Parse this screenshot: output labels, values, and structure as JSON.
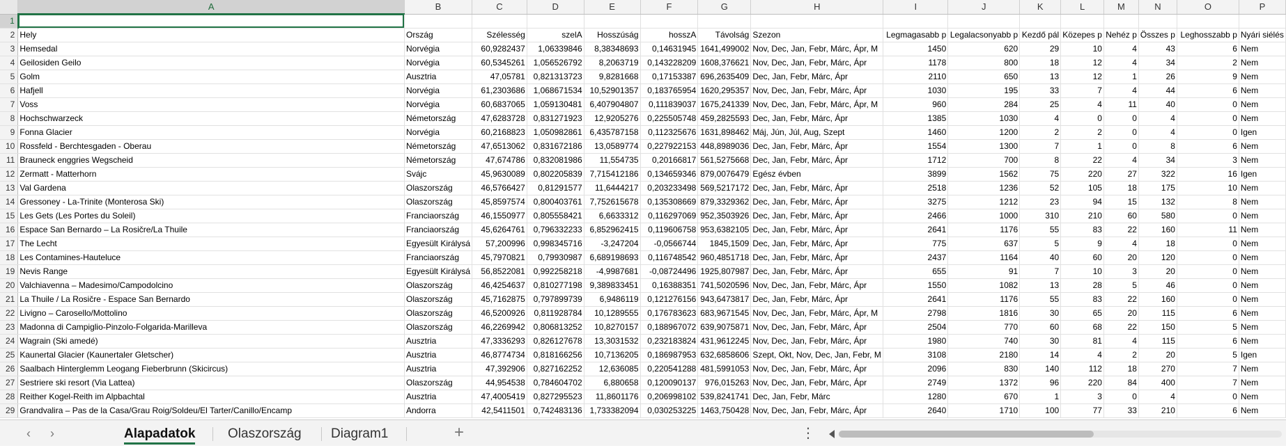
{
  "sheet": {
    "columns": [
      "A",
      "B",
      "C",
      "D",
      "E",
      "F",
      "G",
      "H",
      "I",
      "J",
      "K",
      "L",
      "M",
      "N",
      "O",
      "P"
    ],
    "row1": [
      "",
      "",
      "",
      "",
      "",
      "",
      "",
      "",
      "",
      "",
      "",
      "",
      "",
      "",
      "",
      ""
    ],
    "header_row": [
      "Hely",
      "Ország",
      "Szélesség",
      "szelA",
      "Hosszúság",
      "hosszA",
      "Távolság",
      "Szezon",
      "Legmagasabb p",
      "Legalacsonyabb p",
      "Kezdő pál",
      "Közepes p",
      "Nehéz p",
      "Összes p",
      "Leghosszabb p",
      "Nyári siélés"
    ],
    "rows": [
      [
        "Hemsedal",
        "Norvégia",
        "60,9282437",
        "1,06339846",
        "8,38348693",
        "0,14631945",
        "1641,499002",
        "Nov, Dec, Jan, Febr, Márc, Ápr, M",
        "1450",
        "620",
        "29",
        "10",
        "4",
        "43",
        "6",
        "Nem"
      ],
      [
        "Geilosiden Geilo",
        "Norvégia",
        "60,5345261",
        "1,056526792",
        "8,2063719",
        "0,143228209",
        "1608,376621",
        "Nov, Dec, Jan, Febr, Márc, Ápr",
        "1178",
        "800",
        "18",
        "12",
        "4",
        "34",
        "2",
        "Nem"
      ],
      [
        "Golm",
        "Ausztria",
        "47,05781",
        "0,821313723",
        "9,8281668",
        "0,17153387",
        "696,2635409",
        "Dec, Jan, Febr, Márc, Ápr",
        "2110",
        "650",
        "13",
        "12",
        "1",
        "26",
        "9",
        "Nem"
      ],
      [
        "Hafjell",
        "Norvégia",
        "61,2303686",
        "1,068671534",
        "10,52901357",
        "0,183765954",
        "1620,295357",
        "Nov, Dec, Jan, Febr, Márc, Ápr",
        "1030",
        "195",
        "33",
        "7",
        "4",
        "44",
        "6",
        "Nem"
      ],
      [
        "Voss",
        "Norvégia",
        "60,6837065",
        "1,059130481",
        "6,407904807",
        "0,111839037",
        "1675,241339",
        "Nov, Dec, Jan, Febr, Márc, Ápr, M",
        "960",
        "284",
        "25",
        "4",
        "11",
        "40",
        "0",
        "Nem"
      ],
      [
        "Hochschwarzeck",
        "Németország",
        "47,6283728",
        "0,831271923",
        "12,9205276",
        "0,225505748",
        "459,2825593",
        "Dec, Jan, Febr, Márc, Ápr",
        "1385",
        "1030",
        "4",
        "0",
        "0",
        "4",
        "0",
        "Nem"
      ],
      [
        "Fonna Glacier",
        "Norvégia",
        "60,2168823",
        "1,050982861",
        "6,435787158",
        "0,112325676",
        "1631,898462",
        "Máj, Jún, Júl, Aug, Szept",
        "1460",
        "1200",
        "2",
        "2",
        "0",
        "4",
        "0",
        "Igen"
      ],
      [
        "Rossfeld - Berchtesgaden - Oberau",
        "Németország",
        "47,6513062",
        "0,831672186",
        "13,0589774",
        "0,227922153",
        "448,8989036",
        "Dec, Jan, Febr, Márc, Ápr",
        "1554",
        "1300",
        "7",
        "1",
        "0",
        "8",
        "6",
        "Nem"
      ],
      [
        "Brauneck enggries Wegscheid",
        "Németország",
        "47,674786",
        "0,832081986",
        "11,554735",
        "0,20166817",
        "561,5275668",
        "Dec, Jan, Febr, Márc, Ápr",
        "1712",
        "700",
        "8",
        "22",
        "4",
        "34",
        "3",
        "Nem"
      ],
      [
        "Zermatt - Matterhorn",
        "Svájc",
        "45,9630089",
        "0,802205839",
        "7,715412186",
        "0,134659346",
        "879,0076479",
        "Egész évben",
        "3899",
        "1562",
        "75",
        "220",
        "27",
        "322",
        "16",
        "Igen"
      ],
      [
        "Val Gardena",
        "Olaszország",
        "46,5766427",
        "0,81291577",
        "11,6444217",
        "0,203233498",
        "569,5217172",
        "Dec, Jan, Febr, Márc, Ápr",
        "2518",
        "1236",
        "52",
        "105",
        "18",
        "175",
        "10",
        "Nem"
      ],
      [
        "Gressoney - La-Trinite (Monterosa Ski)",
        "Olaszország",
        "45,8597574",
        "0,800403761",
        "7,752615678",
        "0,135308669",
        "879,3329362",
        "Dec, Jan, Febr, Márc, Ápr",
        "3275",
        "1212",
        "23",
        "94",
        "15",
        "132",
        "8",
        "Nem"
      ],
      [
        "Les Gets (Les Portes du Soleil)",
        "Franciaország",
        "46,1550977",
        "0,805558421",
        "6,6633312",
        "0,116297069",
        "952,3503926",
        "Dec, Jan, Febr, Márc, Ápr",
        "2466",
        "1000",
        "310",
        "210",
        "60",
        "580",
        "0",
        "Nem"
      ],
      [
        "Espace San Bernardo – La Rosičre/La Thuile",
        "Franciaország",
        "45,6264761",
        "0,796332233",
        "6,852962415",
        "0,119606758",
        "953,6382105",
        "Dec, Jan, Febr, Márc, Ápr",
        "2641",
        "1176",
        "55",
        "83",
        "22",
        "160",
        "11",
        "Nem"
      ],
      [
        "The Lecht",
        "Egyesült Királysá",
        "57,200996",
        "0,998345716",
        "-3,247204",
        "-0,0566744",
        "1845,1509",
        "Dec, Jan, Febr, Márc, Ápr",
        "775",
        "637",
        "5",
        "9",
        "4",
        "18",
        "0",
        "Nem"
      ],
      [
        "Les Contamines-Hauteluce",
        "Franciaország",
        "45,7970821",
        "0,79930987",
        "6,689198693",
        "0,116748542",
        "960,4851718",
        "Dec, Jan, Febr, Márc, Ápr",
        "2437",
        "1164",
        "40",
        "60",
        "20",
        "120",
        "0",
        "Nem"
      ],
      [
        "Nevis Range",
        "Egyesült Királysá",
        "56,8522081",
        "0,992258218",
        "-4,9987681",
        "-0,08724496",
        "1925,807987",
        "Dec, Jan, Febr, Márc, Ápr",
        "655",
        "91",
        "7",
        "10",
        "3",
        "20",
        "0",
        "Nem"
      ],
      [
        "Valchiavenna – Madesimo/Campodolcino",
        "Olaszország",
        "46,4254637",
        "0,810277198",
        "9,389833451",
        "0,16388351",
        "741,5020596",
        "Nov, Dec, Jan, Febr, Márc, Ápr",
        "1550",
        "1082",
        "13",
        "28",
        "5",
        "46",
        "0",
        "Nem"
      ],
      [
        "La Thuile / La Rosičre - Espace San Bernardo",
        "Olaszország",
        "45,7162875",
        "0,797899739",
        "6,9486119",
        "0,121276156",
        "943,6473817",
        "Dec, Jan, Febr, Márc, Ápr",
        "2641",
        "1176",
        "55",
        "83",
        "22",
        "160",
        "0",
        "Nem"
      ],
      [
        "Livigno – Carosello/Mottolino",
        "Olaszország",
        "46,5200926",
        "0,811928784",
        "10,1289555",
        "0,176783623",
        "683,9671545",
        "Nov, Dec, Jan, Febr, Márc, Ápr, M",
        "2798",
        "1816",
        "30",
        "65",
        "20",
        "115",
        "6",
        "Nem"
      ],
      [
        "Madonna di Campiglio-Pinzolo-Folgarida-Marilleva",
        "Olaszország",
        "46,2269942",
        "0,806813252",
        "10,8270157",
        "0,188967072",
        "639,9075871",
        "Nov, Dec, Jan, Febr, Márc, Ápr",
        "2504",
        "770",
        "60",
        "68",
        "22",
        "150",
        "5",
        "Nem"
      ],
      [
        "Wagrain (Ski amedé)",
        "Ausztria",
        "47,3336293",
        "0,826127678",
        "13,3031532",
        "0,232183824",
        "431,9612245",
        "Nov, Dec, Jan, Febr, Márc, Ápr",
        "1980",
        "740",
        "30",
        "81",
        "4",
        "115",
        "6",
        "Nem"
      ],
      [
        "Kaunertal Glacier (Kaunertaler Gletscher)",
        "Ausztria",
        "46,8774734",
        "0,818166256",
        "10,7136205",
        "0,186987953",
        "632,6858606",
        "Szept, Okt, Nov, Dec, Jan, Febr, M",
        "3108",
        "2180",
        "14",
        "4",
        "2",
        "20",
        "5",
        "Igen"
      ],
      [
        "Saalbach Hinterglemm Leogang Fieberbrunn (Skicircus)",
        "Ausztria",
        "47,392906",
        "0,827162252",
        "12,636085",
        "0,220541288",
        "481,5991053",
        "Nov, Dec, Jan, Febr, Márc, Ápr",
        "2096",
        "830",
        "140",
        "112",
        "18",
        "270",
        "7",
        "Nem"
      ],
      [
        "Sestriere ski resort (Via Lattea)",
        "Olaszország",
        "44,954538",
        "0,784604702",
        "6,880658",
        "0,120090137",
        "976,015263",
        "Nov, Dec, Jan, Febr, Márc, Ápr",
        "2749",
        "1372",
        "96",
        "220",
        "84",
        "400",
        "7",
        "Nem"
      ],
      [
        "Reither Kogel-Reith im Alpbachtal",
        "Ausztria",
        "47,4005419",
        "0,827295523",
        "11,8601176",
        "0,206998102",
        "539,8241741",
        "Dec, Jan, Febr, Márc",
        "1280",
        "670",
        "1",
        "3",
        "0",
        "4",
        "0",
        "Nem"
      ],
      [
        "Grandvalira – Pas de la Casa/Grau Roig/Soldeu/El Tarter/Canillo/Encamp",
        "Andorra",
        "42,5411501",
        "0,742483136",
        "1,733382094",
        "0,030253225",
        "1463,750428",
        "Nov, Dec, Jan, Febr, Márc, Ápr",
        "2640",
        "1710",
        "100",
        "77",
        "33",
        "210",
        "6",
        "Nem"
      ]
    ]
  },
  "tabs": [
    "Alapadatok",
    "Olaszország",
    "Diagram1"
  ],
  "active_tab": "Alapadatok",
  "colors": {
    "accent": "#217346",
    "grid_line": "#e1e1e1",
    "header_bg": "#f3f3f3"
  },
  "icons": {
    "prev_sheet": "chevron-left-icon",
    "next_sheet": "chevron-right-icon",
    "add_sheet": "plus-icon",
    "more": "more-vertical-icon",
    "scroll_left": "triangle-left-icon"
  }
}
